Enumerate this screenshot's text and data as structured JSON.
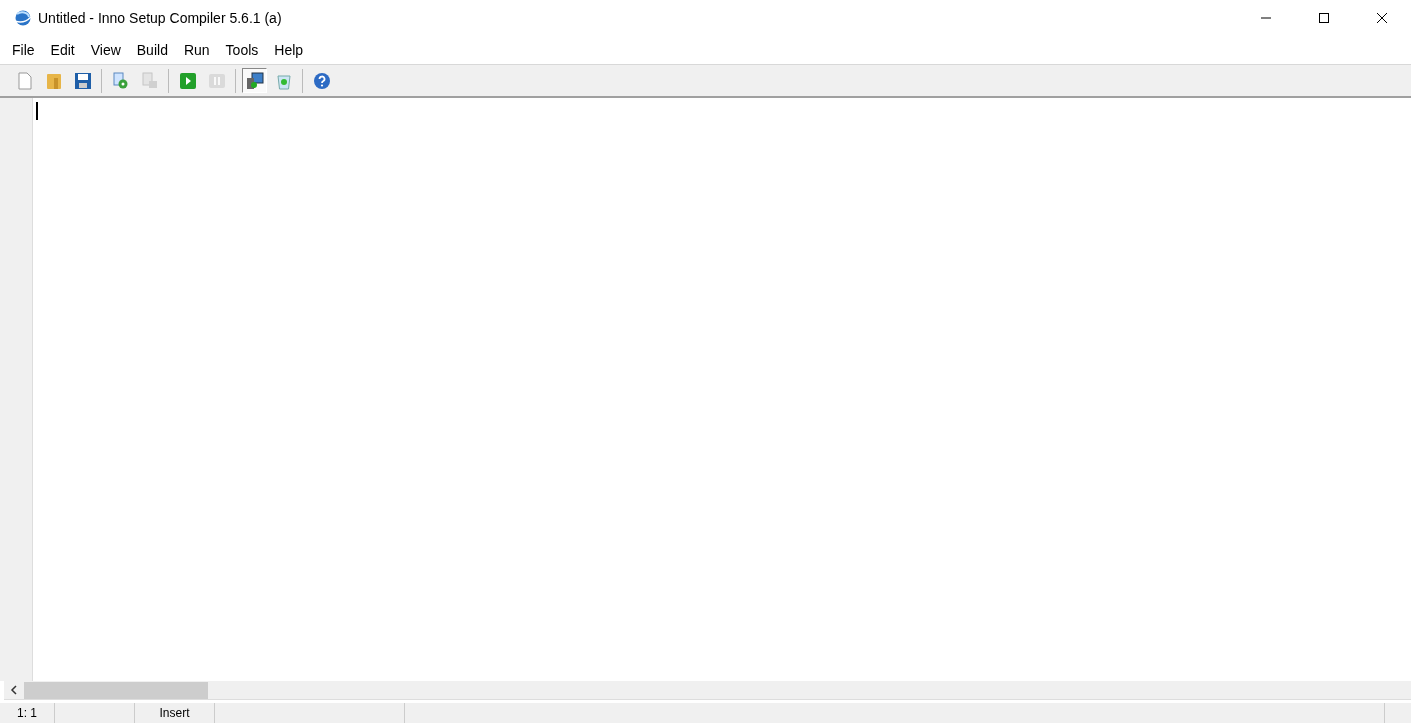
{
  "window": {
    "title": "Untitled - Inno Setup Compiler 5.6.1 (a)"
  },
  "menu": [
    "File",
    "Edit",
    "View",
    "Build",
    "Run",
    "Tools",
    "Help"
  ],
  "toolbar": [
    [
      {
        "kind": "new",
        "disabled": false,
        "pressed": false
      },
      {
        "kind": "open",
        "disabled": false,
        "pressed": false
      },
      {
        "kind": "save",
        "disabled": false,
        "pressed": false
      }
    ],
    [
      {
        "kind": "compile",
        "disabled": false,
        "pressed": false
      },
      {
        "kind": "stop",
        "disabled": true,
        "pressed": false
      }
    ],
    [
      {
        "kind": "run",
        "disabled": false,
        "pressed": false
      },
      {
        "kind": "pause",
        "disabled": true,
        "pressed": false
      }
    ],
    [
      {
        "kind": "target",
        "disabled": false,
        "pressed": true
      },
      {
        "kind": "uninstall",
        "disabled": false,
        "pressed": false
      }
    ],
    [
      {
        "kind": "help",
        "disabled": false,
        "pressed": false
      }
    ]
  ],
  "status_bar": {
    "position": "1:   1",
    "mode": "Insert"
  }
}
